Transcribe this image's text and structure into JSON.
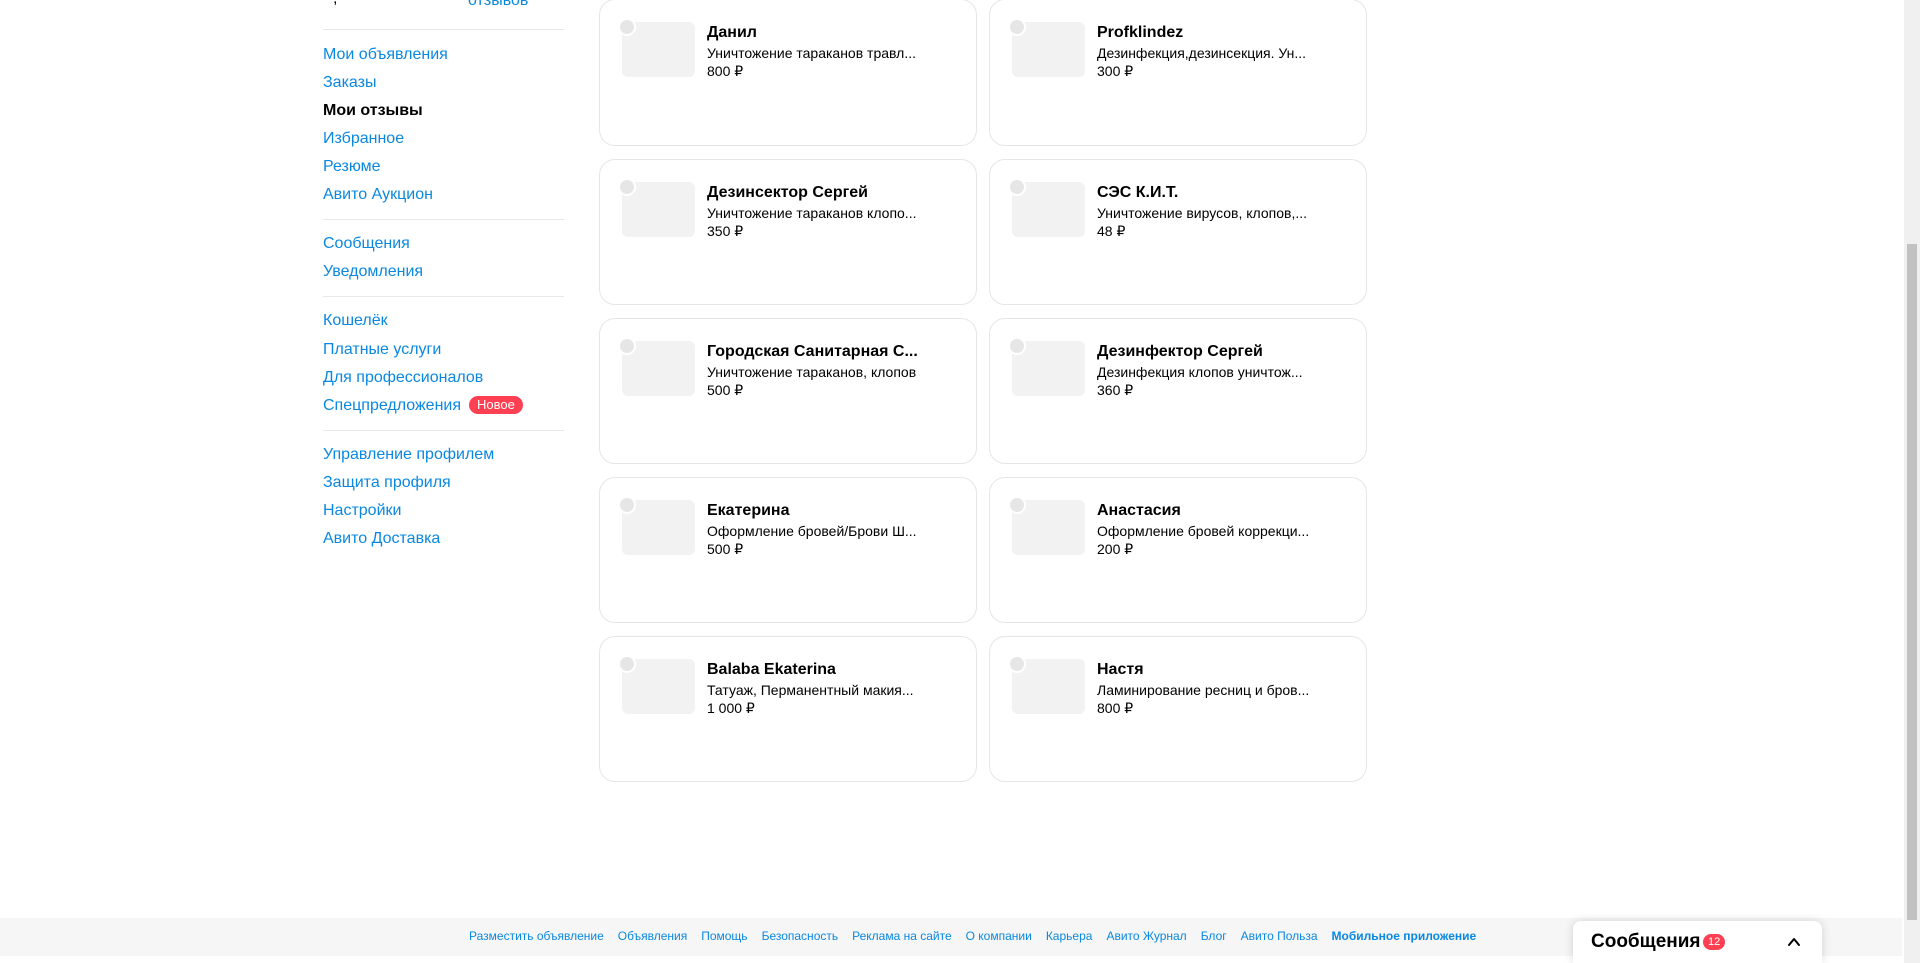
{
  "sidebar": {
    "top_fragment": "отзывов",
    "groups": [
      [
        "Мои объявления",
        "Заказы",
        "Мои отзывы",
        "Избранное",
        "Резюме",
        "Авито Аукцион"
      ],
      [
        "Сообщения",
        "Уведомления"
      ],
      [
        "Кошелёк",
        "Платные услуги",
        "Для профессионалов",
        "Спецпредложения"
      ],
      [
        "Управление профилем",
        "Защита профиля",
        "Настройки",
        "Авито Доставка"
      ]
    ],
    "active": "Мои отзывы",
    "badge": "Новое",
    "items": {
      "my_ads": "Мои объявления",
      "orders": "Заказы",
      "my_reviews": "Мои отзывы",
      "favorites": "Избранное",
      "resume": "Резюме",
      "auction": "Авито Аукцион",
      "messages": "Сообщения",
      "notifications": "Уведомления",
      "wallet": "Кошелёк",
      "paid_services": "Платные услуги",
      "for_pros": "Для профессионалов",
      "special_offers": "Спецпредложения",
      "profile_management": "Управление профилем",
      "profile_protection": "Защита профиля",
      "settings": "Настройки",
      "delivery": "Авито Доставка"
    }
  },
  "cards": [
    {
      "title": "Данил",
      "desc": "Уничтожение тараканов травл...",
      "price": "800 ₽"
    },
    {
      "title": "Profklindez",
      "desc": "Дезинфекция,дезинсекция. Ун...",
      "price": "300 ₽"
    },
    {
      "title": "Дезинсектор Сергей",
      "desc": "Уничтожение тараканов клопо...",
      "price": "350 ₽"
    },
    {
      "title": "СЭС К.И.Т.",
      "desc": "Уничтожение вирусов, клопов,...",
      "price": "48 ₽"
    },
    {
      "title": "Городская Санитарная С...",
      "desc": "Уничтожение тараканов, клопов",
      "price": "500 ₽"
    },
    {
      "title": "Дезинфектор Сергей",
      "desc": "Дезинфекция клопов уничтож...",
      "price": "360 ₽"
    },
    {
      "title": "Екатерина",
      "desc": "Оформление бровей/Брови Ш...",
      "price": "500 ₽"
    },
    {
      "title": "Анастасия",
      "desc": "Оформление бровей коррекци...",
      "price": "200 ₽"
    },
    {
      "title": "Balaba Ekaterina",
      "desc": "Татуаж, Перманентный макия...",
      "price": "1 000 ₽"
    },
    {
      "title": "Настя",
      "desc": "Ламинирование ресниц и бров...",
      "price": "800 ₽"
    }
  ],
  "footer": {
    "links": [
      "Разместить объявление",
      "Объявления",
      "Помощь",
      "Безопасность",
      "Реклама на сайте",
      "О компании",
      "Карьера",
      "Авито Журнал",
      "Блог",
      "Авито Польза",
      "Мобильное приложение"
    ]
  },
  "messages_widget": {
    "label": "Сообщения",
    "count": "12",
    "icon": "chevron-up-icon"
  },
  "colors": {
    "link": "#0a88e0",
    "badge": "#ff4053"
  }
}
